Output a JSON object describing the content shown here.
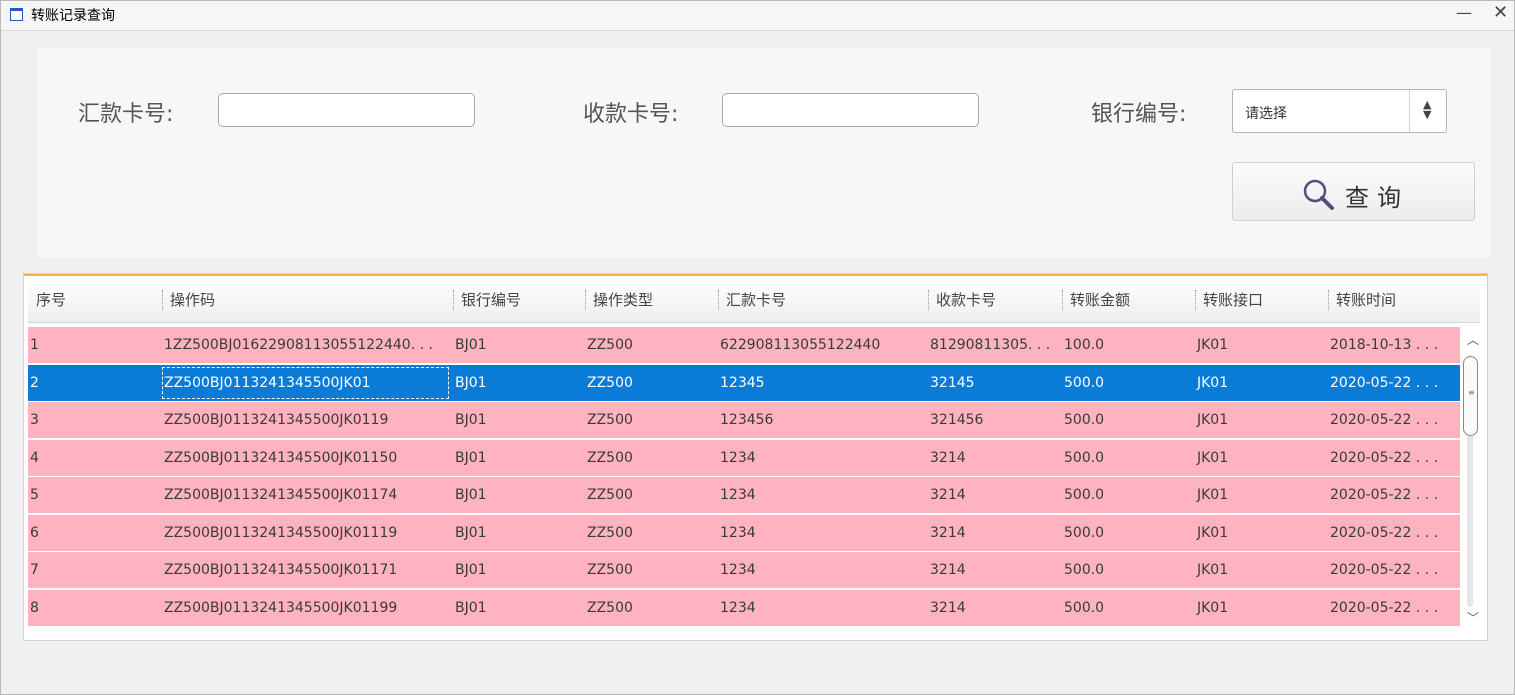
{
  "window": {
    "title": "转账记录查询",
    "minimize": "—",
    "close": "✕"
  },
  "search": {
    "remit_label": "汇款卡号:",
    "remit_value": "",
    "receive_label": "收款卡号:",
    "receive_value": "",
    "bank_label": "银行编号:",
    "bank_select": "请选择",
    "button_label": "查询"
  },
  "table": {
    "columns": [
      "序号",
      "操作码",
      "银行编号",
      "操作类型",
      "汇款卡号",
      "收款卡号",
      "转账金额",
      "转账接口",
      "转账时间"
    ],
    "selected_row": 1,
    "rows": [
      [
        "1",
        "1ZZ500BJ01622908113055122440. . .",
        "BJ01",
        "ZZ500",
        "622908113055122440",
        "81290811305. . .",
        "100.0",
        "JK01",
        "2018-10-13 . . ."
      ],
      [
        "2",
        "ZZ500BJ0113241345500JK01",
        "BJ01",
        "ZZ500",
        "12345",
        "32145",
        "500.0",
        "JK01",
        "2020-05-22 . . ."
      ],
      [
        "3",
        "ZZ500BJ0113241345500JK0119",
        "BJ01",
        "ZZ500",
        "123456",
        "321456",
        "500.0",
        "JK01",
        "2020-05-22 . . ."
      ],
      [
        "4",
        "ZZ500BJ0113241345500JK01150",
        "BJ01",
        "ZZ500",
        "1234",
        "3214",
        "500.0",
        "JK01",
        "2020-05-22 . . ."
      ],
      [
        "5",
        "ZZ500BJ0113241345500JK01174",
        "BJ01",
        "ZZ500",
        "1234",
        "3214",
        "500.0",
        "JK01",
        "2020-05-22 . . ."
      ],
      [
        "6",
        "ZZ500BJ0113241345500JK01119",
        "BJ01",
        "ZZ500",
        "1234",
        "3214",
        "500.0",
        "JK01",
        "2020-05-22 . . ."
      ],
      [
        "7",
        "ZZ500BJ0113241345500JK01171",
        "BJ01",
        "ZZ500",
        "1234",
        "3214",
        "500.0",
        "JK01",
        "2020-05-22 . . ."
      ],
      [
        "8",
        "ZZ500BJ0113241345500JK01199",
        "BJ01",
        "ZZ500",
        "1234",
        "3214",
        "500.0",
        "JK01",
        "2020-05-22 . . ."
      ]
    ]
  },
  "colors": {
    "row_bg": "#ffb3c0",
    "selected_bg": "#0a7bd7",
    "accent": "#f4b34a"
  }
}
